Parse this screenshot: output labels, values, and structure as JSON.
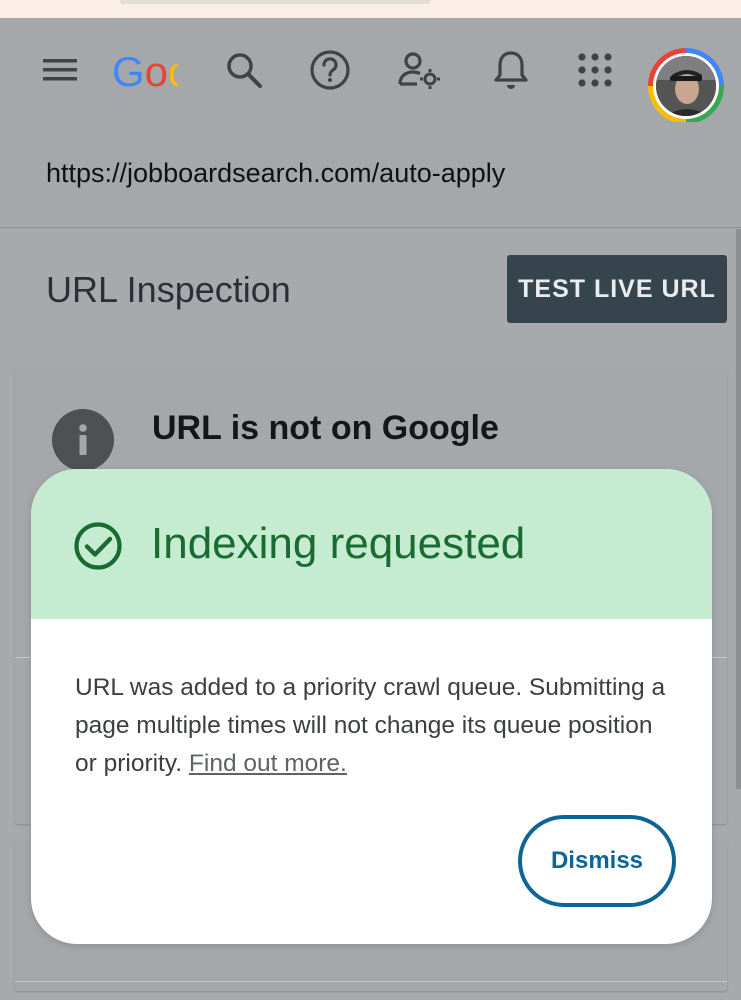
{
  "toolbar": {
    "menu_icon": "hamburger-menu-icon",
    "logo_text": "Google",
    "search_icon": "search-icon",
    "help_icon": "help-icon",
    "user_settings_icon": "user-settings-icon",
    "notifications_icon": "bell-icon",
    "apps_icon": "apps-grid-icon",
    "avatar": "user-avatar"
  },
  "url_bar": {
    "url": "https://jobboardsearch.com/auto-apply"
  },
  "page": {
    "title": "URL Inspection",
    "test_live_url_label": "TEST LIVE URL"
  },
  "status_card": {
    "icon": "info-icon",
    "heading": "URL is not on Google"
  },
  "dialog": {
    "title": "Indexing requested",
    "icon": "check-circle-icon",
    "body_text": "URL was added to a priority crawl queue. Submitting a page multiple times will not change its queue position or priority.",
    "link_text": "Find out more.",
    "dismiss_label": "Dismiss"
  },
  "colors": {
    "dialog_header_bg": "#c5ecd1",
    "dialog_title": "#1a6b32",
    "dismiss_accent": "#0d6496",
    "test_live_btn_bg": "#36454d",
    "scrim": "#a7aaad"
  }
}
